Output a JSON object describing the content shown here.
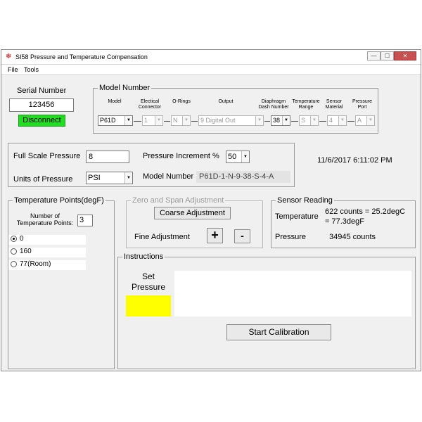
{
  "window": {
    "title": "SI58 Pressure and Temperature Compensation",
    "min": "—",
    "max": "☐",
    "close": "✕"
  },
  "menu": {
    "file": "File",
    "tools": "Tools"
  },
  "serial": {
    "label": "Serial Number",
    "value": "123456",
    "disconnect_label": "Disconnect"
  },
  "model_number": {
    "legend": "Model Number",
    "headers": {
      "model": "Model",
      "connector": "Electical Connector",
      "orings": "O-Rings",
      "output": "Output",
      "diaphragm": "Diaphragm Dash Number",
      "temp_range": "Temperature Range",
      "sensor": "Sensor Material",
      "port": "Pressure Port"
    },
    "values": {
      "model": "P61D",
      "connector": "1",
      "orings": "N",
      "output": "9 Digital Out",
      "diaphragm": "38",
      "temp_range": "S",
      "sensor": "4",
      "port": "A"
    }
  },
  "pressure": {
    "full_scale_label": "Full Scale Pressure",
    "full_scale_value": "8",
    "increment_label": "Pressure Increment %",
    "increment_value": "50",
    "units_label": "Units of Pressure",
    "units_value": "PSI",
    "model_number_label": "Model Number",
    "model_number_value": "P61D-1-N-9-38-S-4-A"
  },
  "datetime": "11/6/2017 6:11:02 PM",
  "temp_points": {
    "legend": "Temperature Points(degF)",
    "count_label": "Number of Temperature Points:",
    "count_value": "3",
    "points": [
      {
        "label": "0",
        "checked": true
      },
      {
        "label": "160",
        "checked": false
      },
      {
        "label": "77(Room)",
        "checked": false
      }
    ]
  },
  "zero_span": {
    "legend": "Zero and Span Adjustment",
    "coarse_label": "Coarse Adjustment",
    "fine_label": "Fine Adjustment",
    "plus": "+",
    "minus": "-"
  },
  "sensor_reading": {
    "legend": "Sensor Reading",
    "temp_label": "Temperature",
    "temp_value_line1": "622 counts = 25.2degC",
    "temp_value_line2": "= 77.3degF",
    "pressure_label": "Pressure",
    "pressure_value": "34945 counts"
  },
  "instructions": {
    "legend": "Instructions",
    "set_pressure_line1": "Set",
    "set_pressure_line2": "Pressure",
    "start_label": "Start Calibration",
    "indicator_color": "#ffff00"
  },
  "colors": {
    "connect_green": "#22dd22",
    "yellow": "#ffff00"
  }
}
